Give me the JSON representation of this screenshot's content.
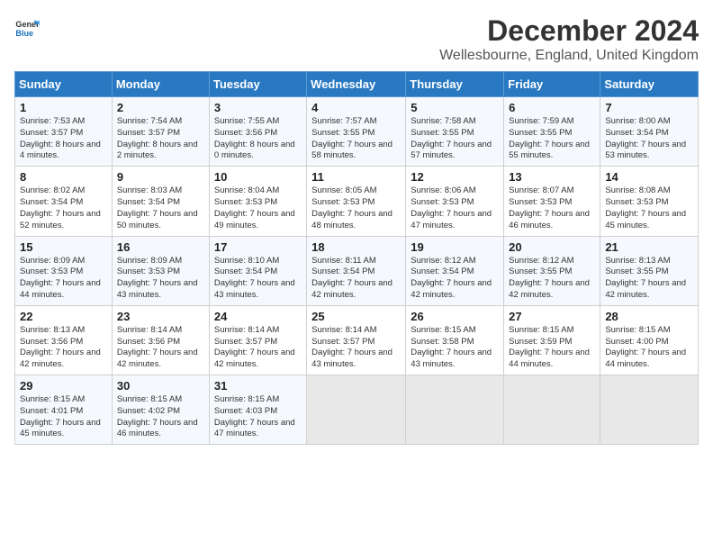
{
  "logo": {
    "line1": "General",
    "line2": "Blue"
  },
  "title": "December 2024",
  "subtitle": "Wellesbourne, England, United Kingdom",
  "headers": [
    "Sunday",
    "Monday",
    "Tuesday",
    "Wednesday",
    "Thursday",
    "Friday",
    "Saturday"
  ],
  "weeks": [
    [
      {
        "day": "1",
        "sunrise": "7:53 AM",
        "sunset": "3:57 PM",
        "daylight": "8 hours and 4 minutes."
      },
      {
        "day": "2",
        "sunrise": "7:54 AM",
        "sunset": "3:57 PM",
        "daylight": "8 hours and 2 minutes."
      },
      {
        "day": "3",
        "sunrise": "7:55 AM",
        "sunset": "3:56 PM",
        "daylight": "8 hours and 0 minutes."
      },
      {
        "day": "4",
        "sunrise": "7:57 AM",
        "sunset": "3:55 PM",
        "daylight": "7 hours and 58 minutes."
      },
      {
        "day": "5",
        "sunrise": "7:58 AM",
        "sunset": "3:55 PM",
        "daylight": "7 hours and 57 minutes."
      },
      {
        "day": "6",
        "sunrise": "7:59 AM",
        "sunset": "3:55 PM",
        "daylight": "7 hours and 55 minutes."
      },
      {
        "day": "7",
        "sunrise": "8:00 AM",
        "sunset": "3:54 PM",
        "daylight": "7 hours and 53 minutes."
      }
    ],
    [
      {
        "day": "8",
        "sunrise": "8:02 AM",
        "sunset": "3:54 PM",
        "daylight": "7 hours and 52 minutes."
      },
      {
        "day": "9",
        "sunrise": "8:03 AM",
        "sunset": "3:54 PM",
        "daylight": "7 hours and 50 minutes."
      },
      {
        "day": "10",
        "sunrise": "8:04 AM",
        "sunset": "3:53 PM",
        "daylight": "7 hours and 49 minutes."
      },
      {
        "day": "11",
        "sunrise": "8:05 AM",
        "sunset": "3:53 PM",
        "daylight": "7 hours and 48 minutes."
      },
      {
        "day": "12",
        "sunrise": "8:06 AM",
        "sunset": "3:53 PM",
        "daylight": "7 hours and 47 minutes."
      },
      {
        "day": "13",
        "sunrise": "8:07 AM",
        "sunset": "3:53 PM",
        "daylight": "7 hours and 46 minutes."
      },
      {
        "day": "14",
        "sunrise": "8:08 AM",
        "sunset": "3:53 PM",
        "daylight": "7 hours and 45 minutes."
      }
    ],
    [
      {
        "day": "15",
        "sunrise": "8:09 AM",
        "sunset": "3:53 PM",
        "daylight": "7 hours and 44 minutes."
      },
      {
        "day": "16",
        "sunrise": "8:09 AM",
        "sunset": "3:53 PM",
        "daylight": "7 hours and 43 minutes."
      },
      {
        "day": "17",
        "sunrise": "8:10 AM",
        "sunset": "3:54 PM",
        "daylight": "7 hours and 43 minutes."
      },
      {
        "day": "18",
        "sunrise": "8:11 AM",
        "sunset": "3:54 PM",
        "daylight": "7 hours and 42 minutes."
      },
      {
        "day": "19",
        "sunrise": "8:12 AM",
        "sunset": "3:54 PM",
        "daylight": "7 hours and 42 minutes."
      },
      {
        "day": "20",
        "sunrise": "8:12 AM",
        "sunset": "3:55 PM",
        "daylight": "7 hours and 42 minutes."
      },
      {
        "day": "21",
        "sunrise": "8:13 AM",
        "sunset": "3:55 PM",
        "daylight": "7 hours and 42 minutes."
      }
    ],
    [
      {
        "day": "22",
        "sunrise": "8:13 AM",
        "sunset": "3:56 PM",
        "daylight": "7 hours and 42 minutes."
      },
      {
        "day": "23",
        "sunrise": "8:14 AM",
        "sunset": "3:56 PM",
        "daylight": "7 hours and 42 minutes."
      },
      {
        "day": "24",
        "sunrise": "8:14 AM",
        "sunset": "3:57 PM",
        "daylight": "7 hours and 42 minutes."
      },
      {
        "day": "25",
        "sunrise": "8:14 AM",
        "sunset": "3:57 PM",
        "daylight": "7 hours and 43 minutes."
      },
      {
        "day": "26",
        "sunrise": "8:15 AM",
        "sunset": "3:58 PM",
        "daylight": "7 hours and 43 minutes."
      },
      {
        "day": "27",
        "sunrise": "8:15 AM",
        "sunset": "3:59 PM",
        "daylight": "7 hours and 44 minutes."
      },
      {
        "day": "28",
        "sunrise": "8:15 AM",
        "sunset": "4:00 PM",
        "daylight": "7 hours and 44 minutes."
      }
    ],
    [
      {
        "day": "29",
        "sunrise": "8:15 AM",
        "sunset": "4:01 PM",
        "daylight": "7 hours and 45 minutes."
      },
      {
        "day": "30",
        "sunrise": "8:15 AM",
        "sunset": "4:02 PM",
        "daylight": "7 hours and 46 minutes."
      },
      {
        "day": "31",
        "sunrise": "8:15 AM",
        "sunset": "4:03 PM",
        "daylight": "7 hours and 47 minutes."
      },
      null,
      null,
      null,
      null
    ]
  ],
  "labels": {
    "sunrise": "Sunrise: ",
    "sunset": "Sunset: ",
    "daylight": "Daylight: "
  }
}
